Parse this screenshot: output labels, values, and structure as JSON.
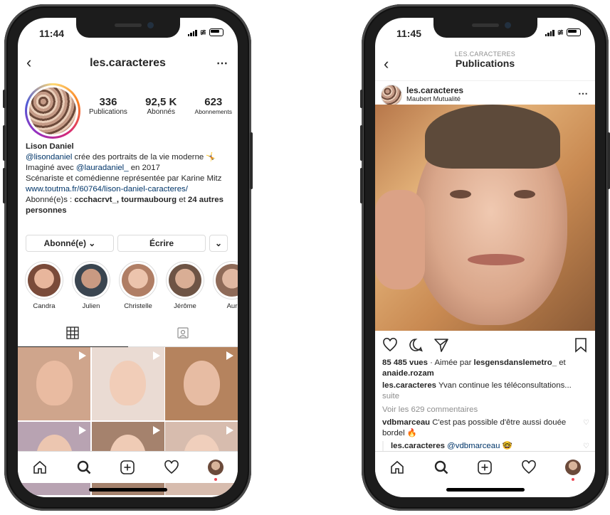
{
  "left": {
    "status_time": "11:44",
    "header_title": "les.caracteres",
    "back_icon": "chevron-left-icon",
    "more_icon": "ellipsis-icon",
    "stats": [
      {
        "value": "336",
        "label": "Publications"
      },
      {
        "value": "92,5 K",
        "label": "Abonnés"
      },
      {
        "value": "623",
        "label": "Abonnements"
      }
    ],
    "bio": {
      "name": "Lison Daniel",
      "line1_mention": "@lisondaniel",
      "line1_text": " crée des portraits de la vie moderne 🤸",
      "line2_prefix": "Imaginé avec ",
      "line2_mention": "@lauradaniel_",
      "line2_suffix": " en 2017",
      "line3": "Scénariste et comédienne représentée par Karine Mitz",
      "link": "www.toutma.fr/60764/lison-daniel-caracteres/",
      "followed_prefix": "Abonné(e)s : ",
      "followed_names": "ccchacrvt_, tourmaubourg",
      "followed_mid": " et ",
      "followed_others": "24 autres personnes"
    },
    "buttons": {
      "following": "Abonné(e) ⌄",
      "message": "Écrire",
      "dropdown": "⌄"
    },
    "highlights": [
      {
        "label": "Candra",
        "color": "#c47a5e"
      },
      {
        "label": "Julien",
        "color": "#5d6b78"
      },
      {
        "label": "Christelle",
        "color": "#d9a48c"
      },
      {
        "label": "Jérôme",
        "color": "#a98a70"
      },
      {
        "label": "Aur",
        "color": "#b8917e"
      }
    ],
    "grid_colors": [
      "#9a6c55",
      "#e7c2ad",
      "#8b6a52",
      "#a88d9c",
      "#6d5a4f",
      "#c9a892"
    ]
  },
  "right": {
    "status_time": "11:45",
    "header_sub": "LES.CARACTERES",
    "header_title": "Publications",
    "post_user": "les.caracteres",
    "post_location": "Maubert Mutualité",
    "views": "85 485 vues",
    "liked_prefix": " · Aimée par ",
    "liked_user": "lesgensdanslemetro_",
    "liked_and": " et",
    "liked_user2": "anaide.rozam",
    "caption_user": "les.caracteres",
    "caption_text": " Yvan continue les téléconsultations...",
    "caption_more": "suite",
    "comments_link": "Voir les 629 commentaires",
    "comment1_user": "vdbmarceau",
    "comment1_text": " C'est pas possible d'être aussi douée bordel 🔥",
    "reply_user": "les.caracteres",
    "reply_mention": " @vdbmarceau 🤓"
  },
  "tabbar_icons": [
    "home-icon",
    "search-icon",
    "add-icon",
    "heart-icon",
    "profile-icon"
  ]
}
